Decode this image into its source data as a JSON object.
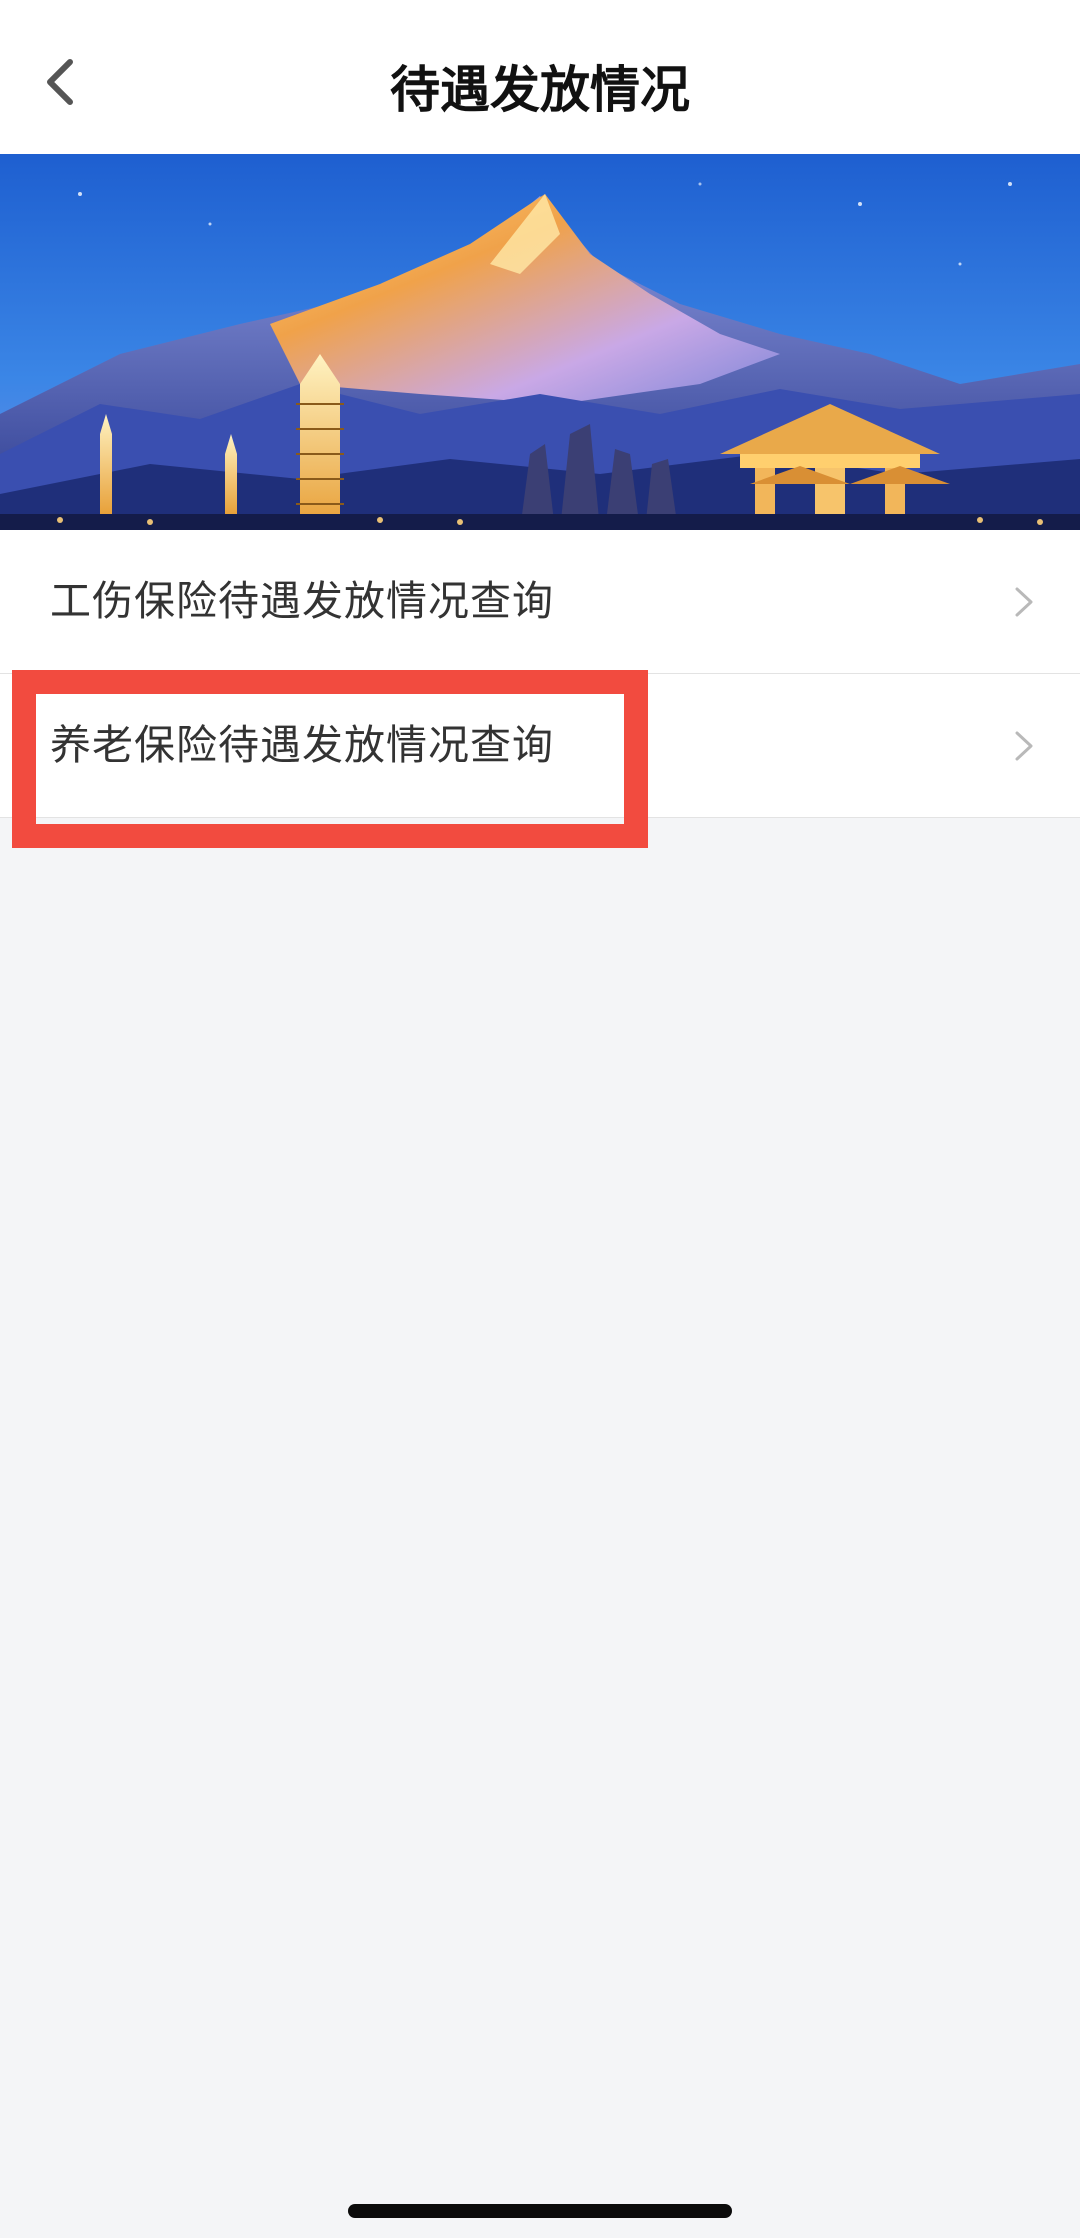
{
  "header": {
    "title": "待遇发放情况",
    "back_icon": "chevron-left-icon"
  },
  "banner": {
    "description_icon": "landscape-banner",
    "sky_color": "#2f6fd6",
    "peak_color": "#f0a24a"
  },
  "menu": {
    "items": [
      {
        "label": "工伤保险待遇发放情况查询",
        "icon": "chevron-right-icon"
      },
      {
        "label": "养老保险待遇发放情况查询",
        "icon": "chevron-right-icon"
      }
    ]
  },
  "annotation": {
    "highlight_color": "#f24b3f",
    "highlighted_item": "养老保险待遇发放情况查询"
  }
}
